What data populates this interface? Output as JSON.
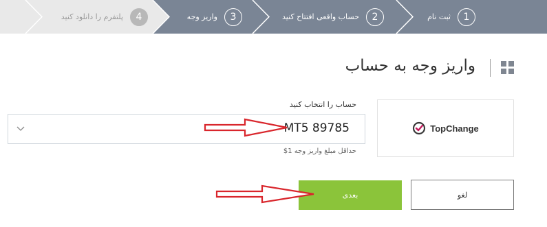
{
  "stepper": {
    "steps": [
      {
        "number": "1",
        "label": "ثبت نام",
        "state": "done"
      },
      {
        "number": "2",
        "label": "حساب واقعی افتتاح کنید",
        "state": "done"
      },
      {
        "number": "3",
        "label": "واریز وجه",
        "state": "current"
      },
      {
        "number": "4",
        "label": "پلتفرم را دانلود کنید",
        "state": "todo"
      }
    ],
    "active_color": "#7a8595",
    "inactive_color": "#e9e9e9"
  },
  "page": {
    "title": "واریز وجه به حساب",
    "title_icon": "grid-icon"
  },
  "account": {
    "label": "حساب را انتخاب کنید",
    "selected": "MT5 89785",
    "hint": "حداقل مبلغ واریز وجه 1$"
  },
  "payment_method": {
    "name": "TopChange",
    "icon": "check-circle-icon"
  },
  "actions": {
    "next_label": "بعدی",
    "cancel_label": "لغو",
    "next_color": "#8bc43a"
  },
  "annotations": {
    "arrow_color": "#d9262c"
  }
}
